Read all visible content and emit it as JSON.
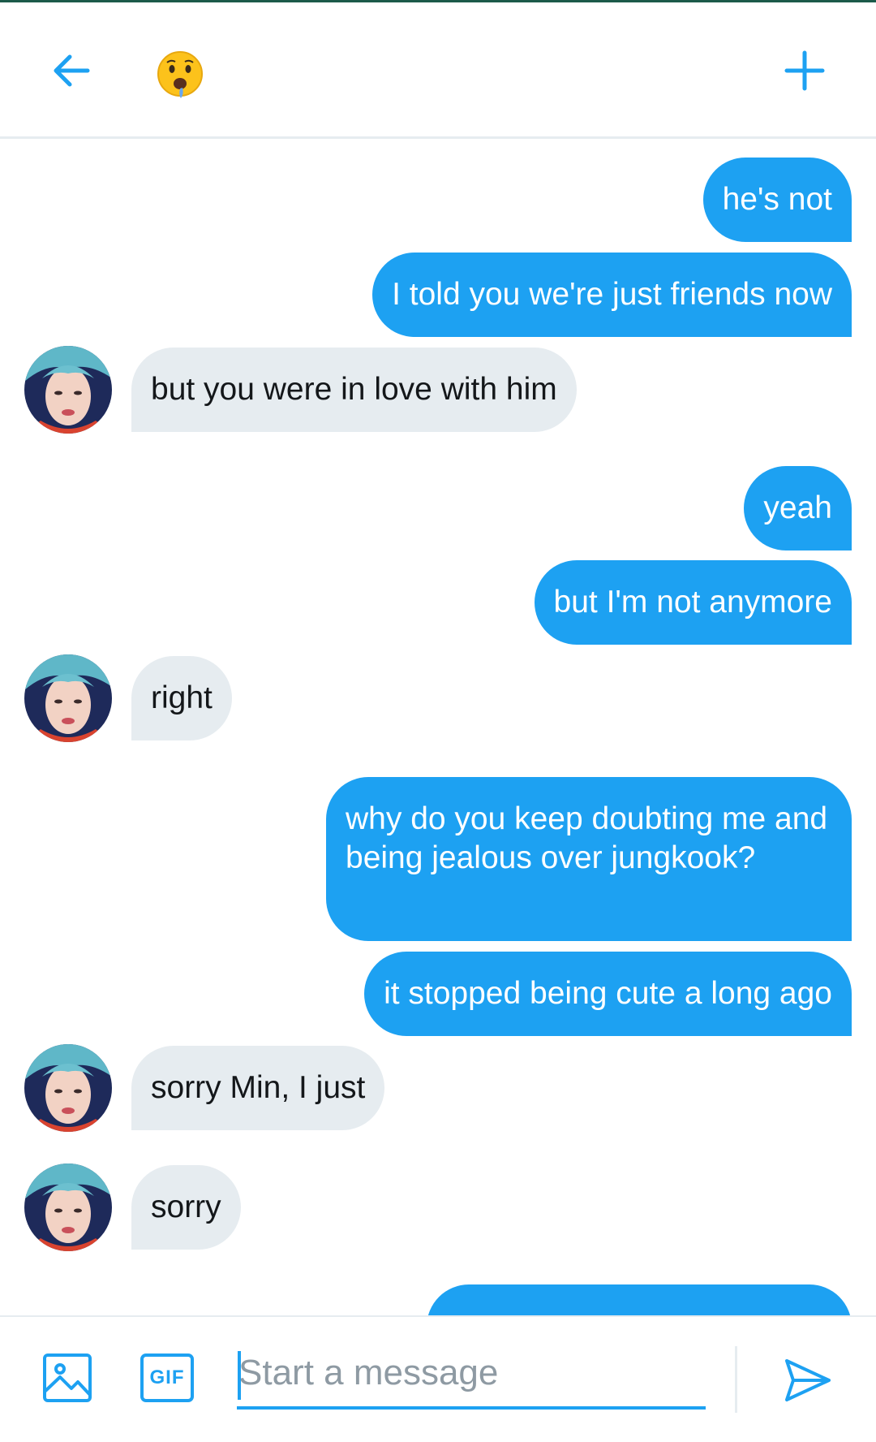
{
  "header": {
    "back_icon": "arrow-left-icon",
    "conversation_avatar": "drooling-face-emoji",
    "new_icon": "plus-icon",
    "accent": "#1da1f2"
  },
  "messages": [
    {
      "side": "out",
      "text": "he's not"
    },
    {
      "side": "out",
      "text": "I told you we're just friends now"
    },
    {
      "side": "in",
      "text": "but you were in love with him"
    },
    {
      "side": "out",
      "text": "yeah"
    },
    {
      "side": "out",
      "text": "but I'm not anymore"
    },
    {
      "side": "in",
      "text": "right"
    },
    {
      "side": "out",
      "text": "why do you keep doubting me and being jealous over jungkook?"
    },
    {
      "side": "out",
      "text": "it stopped being cute a long ago"
    },
    {
      "side": "in",
      "text": "sorry Min, I just"
    },
    {
      "side": "in",
      "text": "sorry"
    }
  ],
  "composer": {
    "placeholder": "Start a message",
    "gif_label": "GIF",
    "image_icon": "image-icon",
    "send_icon": "send-icon"
  },
  "colors": {
    "outgoing_bubble": "#1da1f2",
    "incoming_bubble": "#e6ecf0",
    "text_dark": "#14171a"
  }
}
